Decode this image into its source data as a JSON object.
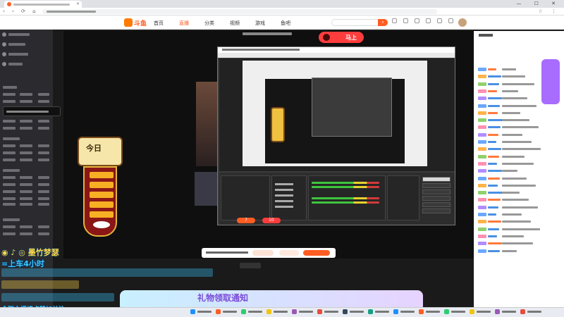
{
  "browser": {
    "window_controls": "— ☐ ✕",
    "nav_icons": "‹ › ⟳ ⌂",
    "right_icons": "☆ ⋮",
    "tab_close": "×"
  },
  "site": {
    "logo_text": "斗鱼",
    "nav": [
      "首页",
      "直播",
      "分类",
      "视频",
      "游戏",
      "鱼吧"
    ],
    "active_nav": 1,
    "search_icon": "⌕"
  },
  "stream": {
    "overlay_tag": "马上",
    "poster_title": "今日"
  },
  "player_bar": {
    "btn_a": "7",
    "btn_b": "10"
  },
  "captions": {
    "line1": "◉ ♪ ◎ 墨竹梦瑟",
    "line2": "=上车4小时",
    "banner": "礼物领取通知",
    "bottom": "全职主播请点赞加关注"
  },
  "colors": {
    "brand": "#ff5d23",
    "sidebar": "#2b2b2f",
    "chat_accent": "#a86cff"
  }
}
